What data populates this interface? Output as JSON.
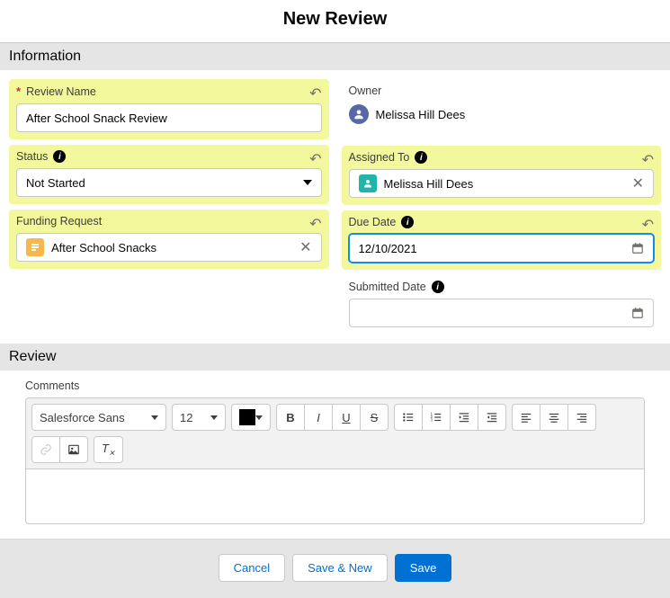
{
  "title": "New Review",
  "sections": {
    "information": "Information",
    "review": "Review"
  },
  "fields": {
    "review_name": {
      "label": "Review Name",
      "value": "After School Snack Review"
    },
    "status": {
      "label": "Status",
      "value": "Not Started"
    },
    "funding_request": {
      "label": "Funding Request",
      "value": "After School Snacks"
    },
    "owner": {
      "label": "Owner",
      "value": "Melissa Hill Dees"
    },
    "assigned_to": {
      "label": "Assigned To",
      "value": "Melissa Hill Dees"
    },
    "due_date": {
      "label": "Due Date",
      "value": "12/10/2021"
    },
    "submitted_date": {
      "label": "Submitted Date",
      "value": ""
    },
    "comments": {
      "label": "Comments"
    }
  },
  "rte": {
    "font": "Salesforce Sans",
    "size": "12"
  },
  "footer": {
    "cancel": "Cancel",
    "save_new": "Save & New",
    "save": "Save"
  }
}
